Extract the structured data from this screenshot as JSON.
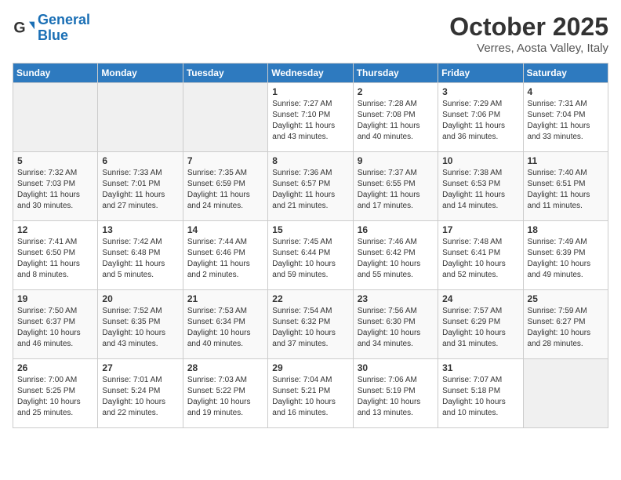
{
  "header": {
    "logo_line1": "General",
    "logo_line2": "Blue",
    "month_title": "October 2025",
    "location": "Verres, Aosta Valley, Italy"
  },
  "days_of_week": [
    "Sunday",
    "Monday",
    "Tuesday",
    "Wednesday",
    "Thursday",
    "Friday",
    "Saturday"
  ],
  "weeks": [
    [
      {
        "day": "",
        "info": ""
      },
      {
        "day": "",
        "info": ""
      },
      {
        "day": "",
        "info": ""
      },
      {
        "day": "1",
        "info": "Sunrise: 7:27 AM\nSunset: 7:10 PM\nDaylight: 11 hours\nand 43 minutes."
      },
      {
        "day": "2",
        "info": "Sunrise: 7:28 AM\nSunset: 7:08 PM\nDaylight: 11 hours\nand 40 minutes."
      },
      {
        "day": "3",
        "info": "Sunrise: 7:29 AM\nSunset: 7:06 PM\nDaylight: 11 hours\nand 36 minutes."
      },
      {
        "day": "4",
        "info": "Sunrise: 7:31 AM\nSunset: 7:04 PM\nDaylight: 11 hours\nand 33 minutes."
      }
    ],
    [
      {
        "day": "5",
        "info": "Sunrise: 7:32 AM\nSunset: 7:03 PM\nDaylight: 11 hours\nand 30 minutes."
      },
      {
        "day": "6",
        "info": "Sunrise: 7:33 AM\nSunset: 7:01 PM\nDaylight: 11 hours\nand 27 minutes."
      },
      {
        "day": "7",
        "info": "Sunrise: 7:35 AM\nSunset: 6:59 PM\nDaylight: 11 hours\nand 24 minutes."
      },
      {
        "day": "8",
        "info": "Sunrise: 7:36 AM\nSunset: 6:57 PM\nDaylight: 11 hours\nand 21 minutes."
      },
      {
        "day": "9",
        "info": "Sunrise: 7:37 AM\nSunset: 6:55 PM\nDaylight: 11 hours\nand 17 minutes."
      },
      {
        "day": "10",
        "info": "Sunrise: 7:38 AM\nSunset: 6:53 PM\nDaylight: 11 hours\nand 14 minutes."
      },
      {
        "day": "11",
        "info": "Sunrise: 7:40 AM\nSunset: 6:51 PM\nDaylight: 11 hours\nand 11 minutes."
      }
    ],
    [
      {
        "day": "12",
        "info": "Sunrise: 7:41 AM\nSunset: 6:50 PM\nDaylight: 11 hours\nand 8 minutes."
      },
      {
        "day": "13",
        "info": "Sunrise: 7:42 AM\nSunset: 6:48 PM\nDaylight: 11 hours\nand 5 minutes."
      },
      {
        "day": "14",
        "info": "Sunrise: 7:44 AM\nSunset: 6:46 PM\nDaylight: 11 hours\nand 2 minutes."
      },
      {
        "day": "15",
        "info": "Sunrise: 7:45 AM\nSunset: 6:44 PM\nDaylight: 10 hours\nand 59 minutes."
      },
      {
        "day": "16",
        "info": "Sunrise: 7:46 AM\nSunset: 6:42 PM\nDaylight: 10 hours\nand 55 minutes."
      },
      {
        "day": "17",
        "info": "Sunrise: 7:48 AM\nSunset: 6:41 PM\nDaylight: 10 hours\nand 52 minutes."
      },
      {
        "day": "18",
        "info": "Sunrise: 7:49 AM\nSunset: 6:39 PM\nDaylight: 10 hours\nand 49 minutes."
      }
    ],
    [
      {
        "day": "19",
        "info": "Sunrise: 7:50 AM\nSunset: 6:37 PM\nDaylight: 10 hours\nand 46 minutes."
      },
      {
        "day": "20",
        "info": "Sunrise: 7:52 AM\nSunset: 6:35 PM\nDaylight: 10 hours\nand 43 minutes."
      },
      {
        "day": "21",
        "info": "Sunrise: 7:53 AM\nSunset: 6:34 PM\nDaylight: 10 hours\nand 40 minutes."
      },
      {
        "day": "22",
        "info": "Sunrise: 7:54 AM\nSunset: 6:32 PM\nDaylight: 10 hours\nand 37 minutes."
      },
      {
        "day": "23",
        "info": "Sunrise: 7:56 AM\nSunset: 6:30 PM\nDaylight: 10 hours\nand 34 minutes."
      },
      {
        "day": "24",
        "info": "Sunrise: 7:57 AM\nSunset: 6:29 PM\nDaylight: 10 hours\nand 31 minutes."
      },
      {
        "day": "25",
        "info": "Sunrise: 7:59 AM\nSunset: 6:27 PM\nDaylight: 10 hours\nand 28 minutes."
      }
    ],
    [
      {
        "day": "26",
        "info": "Sunrise: 7:00 AM\nSunset: 5:25 PM\nDaylight: 10 hours\nand 25 minutes."
      },
      {
        "day": "27",
        "info": "Sunrise: 7:01 AM\nSunset: 5:24 PM\nDaylight: 10 hours\nand 22 minutes."
      },
      {
        "day": "28",
        "info": "Sunrise: 7:03 AM\nSunset: 5:22 PM\nDaylight: 10 hours\nand 19 minutes."
      },
      {
        "day": "29",
        "info": "Sunrise: 7:04 AM\nSunset: 5:21 PM\nDaylight: 10 hours\nand 16 minutes."
      },
      {
        "day": "30",
        "info": "Sunrise: 7:06 AM\nSunset: 5:19 PM\nDaylight: 10 hours\nand 13 minutes."
      },
      {
        "day": "31",
        "info": "Sunrise: 7:07 AM\nSunset: 5:18 PM\nDaylight: 10 hours\nand 10 minutes."
      },
      {
        "day": "",
        "info": ""
      }
    ]
  ]
}
